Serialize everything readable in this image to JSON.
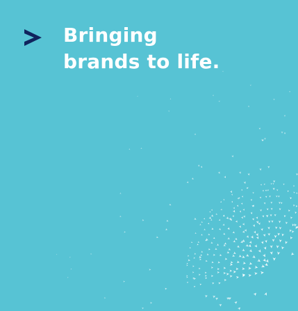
{
  "headline": {
    "line1": "Bringing",
    "line2": "brands to life."
  },
  "colors": {
    "background": "#57c3d4",
    "chevron": "#10245d",
    "text": "#ffffff",
    "pattern": "#ffffff"
  },
  "icons": {
    "chevron": "chevron-right-icon",
    "pattern": "arrow-particle-pattern"
  }
}
